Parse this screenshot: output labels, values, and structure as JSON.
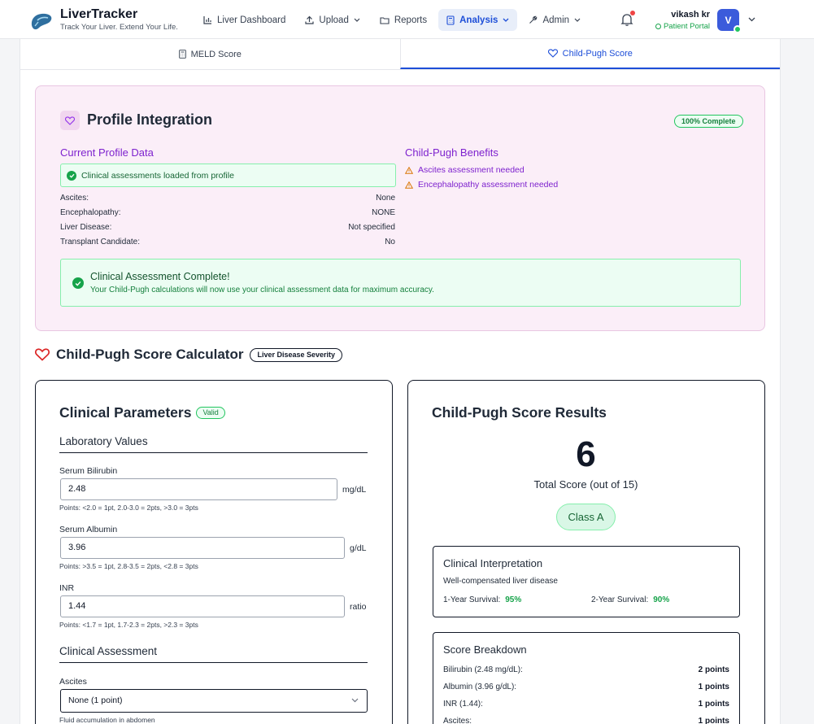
{
  "app": {
    "name": "LiverTracker",
    "tagline": "Track Your Liver. Extend Your Life."
  },
  "nav": [
    {
      "label": "Liver Dashboard",
      "icon": "bar-chart-icon"
    },
    {
      "label": "Upload",
      "icon": "upload-icon",
      "dropdown": true
    },
    {
      "label": "Reports",
      "icon": "folder-icon"
    },
    {
      "label": "Analysis",
      "icon": "calculator-icon",
      "dropdown": true,
      "active": true
    },
    {
      "label": "Admin",
      "icon": "wrench-icon",
      "dropdown": true
    }
  ],
  "user": {
    "name": "vikash kr",
    "portal": "Patient Portal",
    "initial": "V"
  },
  "tabs": [
    {
      "label": "MELD Score",
      "icon": "calculator-icon"
    },
    {
      "label": "Child-Pugh Score",
      "icon": "heart-icon",
      "active": true
    }
  ],
  "profile": {
    "title": "Profile Integration",
    "badge": "100% Complete",
    "current_heading": "Current Profile Data",
    "loaded_text": "Clinical assessments loaded from profile",
    "rows": [
      {
        "label": "Ascites:",
        "value": "None"
      },
      {
        "label": "Encephalopathy:",
        "value": "NONE"
      },
      {
        "label": "Liver Disease:",
        "value": "Not specified"
      },
      {
        "label": "Transplant Candidate:",
        "value": "No"
      }
    ],
    "benefits_heading": "Child-Pugh Benefits",
    "benefits": [
      "Ascites assessment needed",
      "Encephalopathy assessment needed"
    ],
    "complete_title": "Clinical Assessment Complete!",
    "complete_text": "Your Child-Pugh calculations will now use your clinical assessment data for maximum accuracy."
  },
  "calculator": {
    "title": "Child-Pugh Score Calculator",
    "badge": "Liver Disease Severity",
    "params_title": "Clinical Parameters",
    "valid_badge": "Valid",
    "lab_heading": "Laboratory Values",
    "fields": [
      {
        "label": "Serum Bilirubin",
        "value": "2.48",
        "unit": "mg/dL",
        "hint": "Points: <2.0 = 1pt, 2.0-3.0 = 2pts, >3.0 = 3pts"
      },
      {
        "label": "Serum Albumin",
        "value": "3.96",
        "unit": "g/dL",
        "hint": "Points: >3.5 = 1pt, 2.8-3.5 = 2pts, <2.8 = 3pts"
      },
      {
        "label": "INR",
        "value": "1.44",
        "unit": "ratio",
        "hint": "Points: <1.7 = 1pt, 1.7-2.3 = 2pts, >2.3 = 3pts"
      }
    ],
    "clinical_heading": "Clinical Assessment",
    "ascites_label": "Ascites",
    "ascites_value": "None (1 point)",
    "ascites_hint": "Fluid accumulation in abdomen"
  },
  "results": {
    "title": "Child-Pugh Score Results",
    "score": "6",
    "score_label": "Total Score (out of 15)",
    "class": "Class A",
    "interp_heading": "Clinical Interpretation",
    "interp_text": "Well-compensated liver disease",
    "survival_1_label": "1-Year Survival:",
    "survival_1": "95%",
    "survival_2_label": "2-Year Survival:",
    "survival_2": "90%",
    "breakdown_heading": "Score Breakdown",
    "breakdown": [
      {
        "label": "Bilirubin (2.48 mg/dL):",
        "points": "2 points"
      },
      {
        "label": "Albumin (3.96 g/dL):",
        "points": "1 points"
      },
      {
        "label": "INR (1.44):",
        "points": "1 points"
      },
      {
        "label": "Ascites:",
        "points": "1 points"
      }
    ]
  },
  "colors": {
    "primary": "#1d4ed8",
    "success": "#16a34a",
    "purple": "#7e22ce",
    "danger": "#dc2626"
  }
}
